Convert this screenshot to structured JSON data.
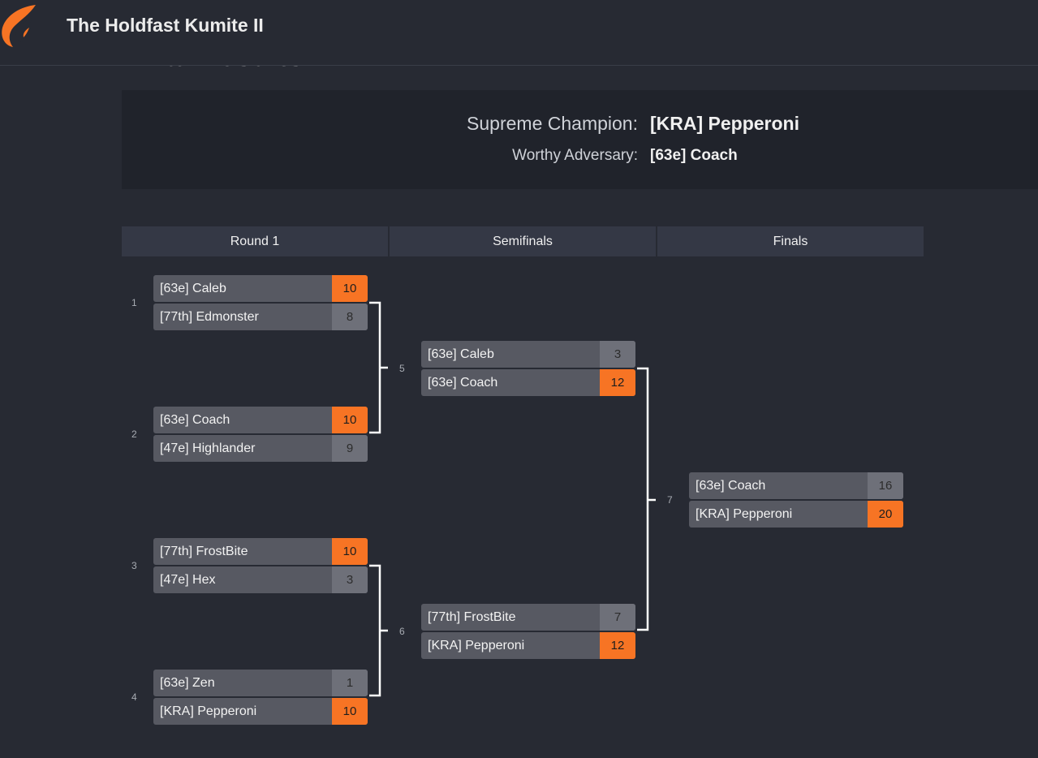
{
  "site": {
    "title": "The Holdfast Kumite II",
    "logo_icon": "wing-icon",
    "accent": "#f77424"
  },
  "page": {
    "title": "Final Results"
  },
  "results": {
    "champion_label": "Supreme Champion:",
    "champion_value": "[KRA] Pepperoni",
    "adversary_label": "Worthy Adversary:",
    "adversary_value": "[63e] Coach"
  },
  "rounds": [
    "Round 1",
    "Semifinals",
    "Finals"
  ],
  "matches": [
    {
      "num": "1",
      "top": {
        "name": "[63e] Caleb",
        "score": "10",
        "win": true
      },
      "bottom": {
        "name": "[77th] Edmonster",
        "score": "8",
        "win": false
      }
    },
    {
      "num": "2",
      "top": {
        "name": "[63e] Coach",
        "score": "10",
        "win": true
      },
      "bottom": {
        "name": "[47e] Highlander",
        "score": "9",
        "win": false
      }
    },
    {
      "num": "3",
      "top": {
        "name": "[77th] FrostBite",
        "score": "10",
        "win": true
      },
      "bottom": {
        "name": "[47e] Hex",
        "score": "3",
        "win": false
      }
    },
    {
      "num": "4",
      "top": {
        "name": "[63e] Zen",
        "score": "1",
        "win": false
      },
      "bottom": {
        "name": "[KRA] Pepperoni",
        "score": "10",
        "win": true
      }
    },
    {
      "num": "5",
      "top": {
        "name": "[63e] Caleb",
        "score": "3",
        "win": false
      },
      "bottom": {
        "name": "[63e] Coach",
        "score": "12",
        "win": true
      }
    },
    {
      "num": "6",
      "top": {
        "name": "[77th] FrostBite",
        "score": "7",
        "win": false
      },
      "bottom": {
        "name": "[KRA] Pepperoni",
        "score": "12",
        "win": true
      }
    },
    {
      "num": "7",
      "top": {
        "name": "[63e] Coach",
        "score": "16",
        "win": false
      },
      "bottom": {
        "name": "[KRA] Pepperoni",
        "score": "20",
        "win": true
      }
    }
  ]
}
